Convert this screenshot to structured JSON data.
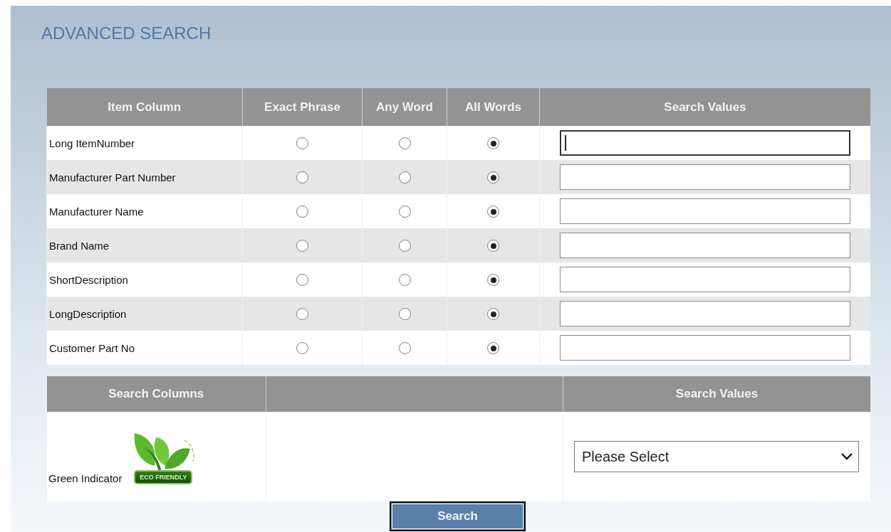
{
  "title": "ADVANCED SEARCH",
  "item_table": {
    "columns": [
      "Item Column",
      "Exact Phrase",
      "Any Word",
      "All Words",
      "Search Values"
    ],
    "rows": [
      {
        "label": "Long ItemNumber",
        "options": [
          {
            "selected": false
          },
          {
            "selected": false
          },
          {
            "selected": true
          }
        ],
        "focused": true
      },
      {
        "label": "Manufacturer Part Number",
        "options": [
          {
            "selected": false
          },
          {
            "selected": false
          },
          {
            "selected": true
          }
        ],
        "focused": false
      },
      {
        "label": "Manufacturer Name",
        "options": [
          {
            "selected": false
          },
          {
            "selected": false
          },
          {
            "selected": true
          }
        ],
        "focused": false
      },
      {
        "label": "Brand Name",
        "options": [
          {
            "selected": false
          },
          {
            "selected": false
          },
          {
            "selected": true
          }
        ],
        "focused": false
      },
      {
        "label": "ShortDescription",
        "options": [
          {
            "selected": false
          },
          {
            "selected": false
          },
          {
            "selected": true
          }
        ],
        "focused": false
      },
      {
        "label": "LongDescription",
        "options": [
          {
            "selected": false
          },
          {
            "selected": false
          },
          {
            "selected": true
          }
        ],
        "focused": false
      },
      {
        "label": "Customer Part No",
        "options": [
          {
            "selected": false
          },
          {
            "selected": false
          },
          {
            "selected": true
          }
        ],
        "focused": false
      }
    ]
  },
  "column_table": {
    "columns": [
      "Search Columns",
      "Search Values"
    ],
    "rows": [
      {
        "label": "Green Indicator",
        "badge": "ECO FRIENDLY",
        "select": "Please Select"
      }
    ]
  },
  "search_button": "Search"
}
